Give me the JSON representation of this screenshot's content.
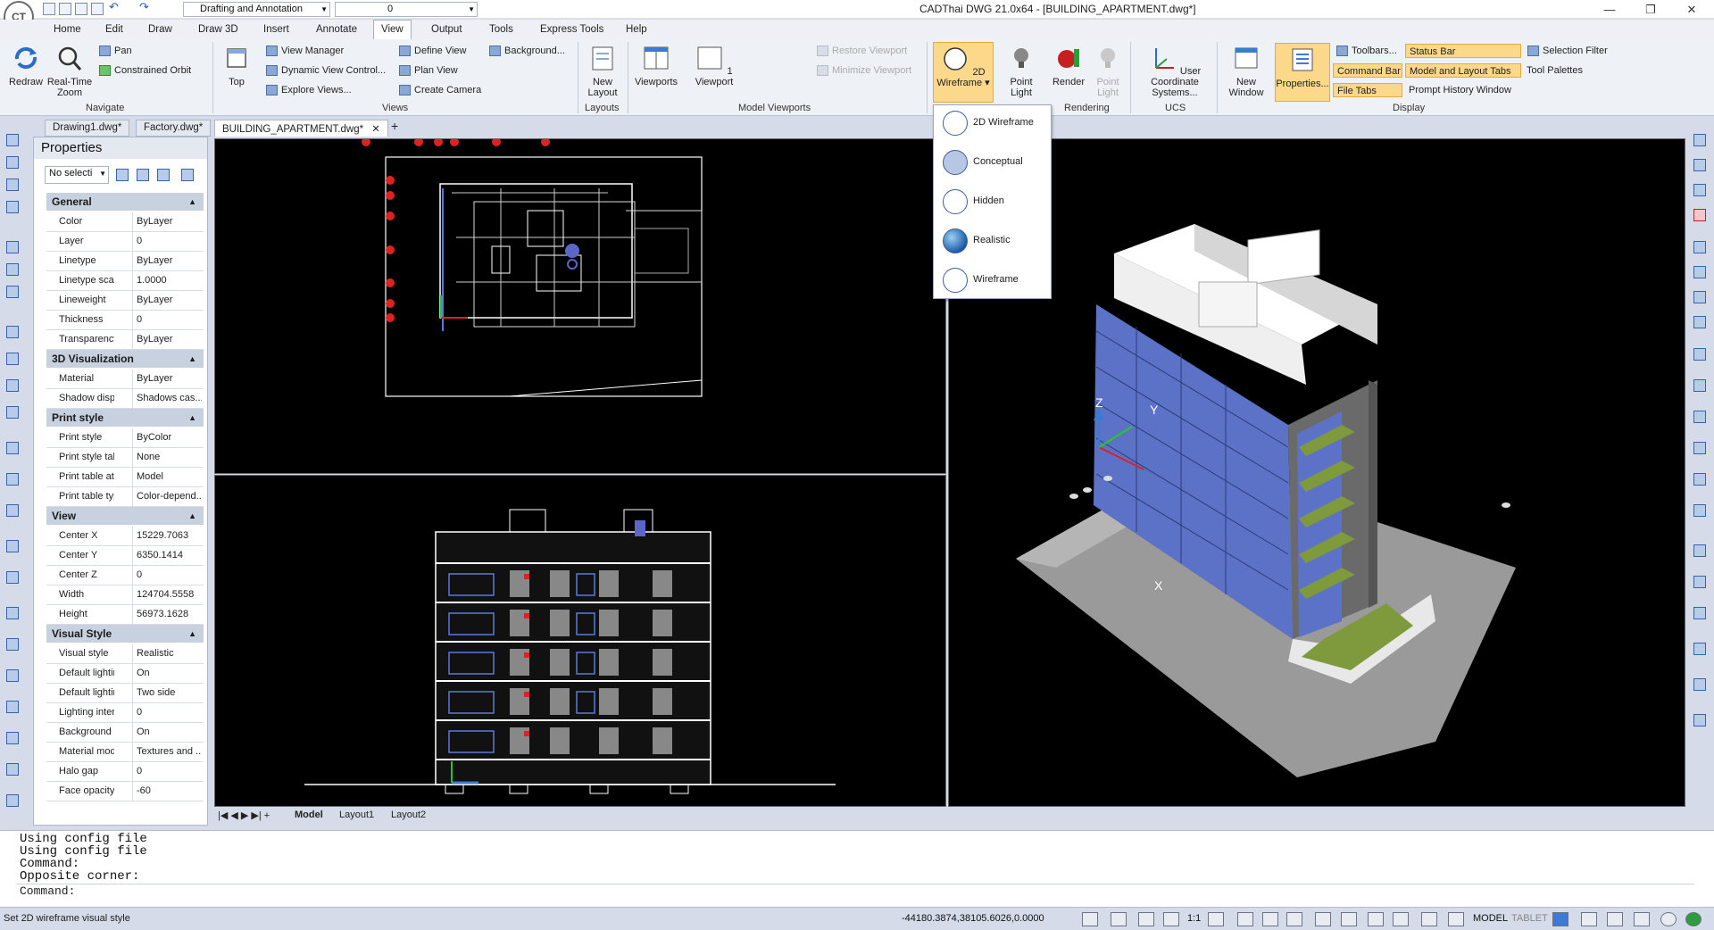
{
  "app": {
    "title": "CADThai DWG 21.0x64 - [BUILDING_APARTMENT.dwg*]",
    "workspace": "Drafting and Annotation",
    "layer_value": "0"
  },
  "menus": [
    "Home",
    "Edit",
    "Draw",
    "Draw 3D",
    "Insert",
    "Annotate",
    "View",
    "Output",
    "Tools",
    "Express Tools",
    "Help"
  ],
  "active_menu": "View",
  "ribbon": {
    "navigate": {
      "label": "Navigate",
      "redraw": "Redraw",
      "realtime_zoom": "Real-Time Zoom",
      "pan": "Pan",
      "orbit": "Constrained Orbit"
    },
    "views": {
      "label": "Views",
      "top": "Top",
      "view_manager": "View Manager",
      "dynamic_view": "Dynamic View Control...",
      "explore_views": "Explore Views...",
      "define_view": "Define View",
      "plan_view": "Plan View",
      "create_camera": "Create Camera",
      "background": "Background..."
    },
    "layouts": {
      "label": "Layouts",
      "new_layout": "New Layout"
    },
    "model_viewports": {
      "label": "Model Viewports",
      "viewports": "Viewports",
      "one_viewport": "1 Viewport",
      "restore": "Restore Viewport",
      "minimize": "Minimize Viewport"
    },
    "rendering": {
      "label": "Rendering",
      "wireframe": "2D Wireframe",
      "point_light": "Point Light",
      "render": "Render",
      "point_light2": "Point Light"
    },
    "ucs": {
      "label": "UCS",
      "user_coord": "User Coordinate Systems..."
    },
    "display": {
      "label": "Display",
      "new_window": "New Window",
      "properties": "Properties...",
      "toolbars": "Toolbars...",
      "command_bar": "Command Bar",
      "file_tabs": "File Tabs",
      "status_bar": "Status Bar",
      "model_layout_tabs": "Model and Layout Tabs",
      "prompt_history": "Prompt History Window",
      "selection_filter": "Selection Filter",
      "tool_palettes": "Tool Palettes"
    }
  },
  "doc_tabs": [
    "Drawing1.dwg*",
    "Factory.dwg*",
    "BUILDING_APARTMENT.dwg*"
  ],
  "properties": {
    "title": "Properties",
    "selection": "No selecti",
    "sections": [
      {
        "name": "General",
        "rows": [
          [
            "Color",
            "ByLayer"
          ],
          [
            "Layer",
            "0"
          ],
          [
            "Linetype",
            "ByLayer"
          ],
          [
            "Linetype scale",
            "1.0000"
          ],
          [
            "Lineweight",
            "ByLayer"
          ],
          [
            "Thickness",
            "0"
          ],
          [
            "Transparency",
            "ByLayer"
          ]
        ]
      },
      {
        "name": "3D Visualization",
        "rows": [
          [
            "Material",
            "ByLayer"
          ],
          [
            "Shadow displ...",
            "Shadows cas..."
          ]
        ]
      },
      {
        "name": "Print style",
        "rows": [
          [
            "Print style",
            "ByColor"
          ],
          [
            "Print style table",
            "None"
          ],
          [
            "Print table att...",
            "Model"
          ],
          [
            "Print table type",
            "Color-depend..."
          ]
        ]
      },
      {
        "name": "View",
        "rows": [
          [
            "Center X",
            "15229.7063"
          ],
          [
            "Center Y",
            "6350.1414"
          ],
          [
            "Center Z",
            "0"
          ],
          [
            "Width",
            "124704.5558"
          ],
          [
            "Height",
            "56973.1628"
          ]
        ]
      },
      {
        "name": "Visual Style",
        "rows": [
          [
            "Visual style",
            "Realistic"
          ],
          [
            "Default lighting",
            "On"
          ],
          [
            "Default lightin...",
            "Two side"
          ],
          [
            "Lighting inten...",
            "0"
          ],
          [
            "Background",
            "On"
          ],
          [
            "Material mode",
            "Textures and ..."
          ],
          [
            "Halo gap",
            "0"
          ],
          [
            "Face opacity",
            "-60"
          ]
        ]
      }
    ]
  },
  "visual_styles_menu": [
    "2D Wireframe",
    "Conceptual",
    "Hidden",
    "Realistic",
    "Wireframe"
  ],
  "layout_tabs": [
    "Model",
    "Layout1",
    "Layout2"
  ],
  "command_history": [
    "Using config file",
    "Using config file",
    "Command:",
    "Opposite corner:"
  ],
  "command_prompt": "Command:",
  "status": {
    "message": "Set 2D wireframe visual style",
    "coordinates": "-44180.3874,38105.6026,0.0000",
    "scale": "1:1",
    "model": "MODEL",
    "tablet": "TABLET"
  },
  "axis_labels": {
    "x": "X",
    "y": "Y",
    "z": "Z"
  },
  "colors": {
    "accent": "#fbd88a",
    "ribbon_bg": "#eef1f6",
    "viewport": "#000000",
    "building_glass": "#5b72c6"
  }
}
